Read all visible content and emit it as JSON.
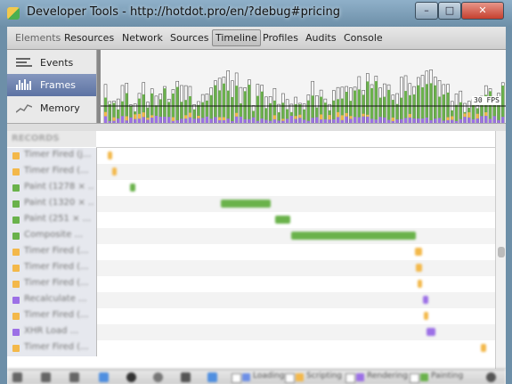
{
  "window": {
    "title": "Developer Tools - http://hotdot.pro/en/?debug#pricing",
    "min_label": "–",
    "max_label": "□",
    "close_label": "✕"
  },
  "tabs": [
    {
      "label": "Elements"
    },
    {
      "label": "Resources"
    },
    {
      "label": "Network"
    },
    {
      "label": "Sources"
    },
    {
      "label": "Timeline",
      "active": true
    },
    {
      "label": "Profiles"
    },
    {
      "label": "Audits"
    },
    {
      "label": "Console"
    }
  ],
  "sidebar": {
    "items": [
      {
        "label": "Events",
        "icon": "events-icon"
      },
      {
        "label": "Frames",
        "icon": "frames-icon",
        "active": true
      },
      {
        "label": "Memory",
        "icon": "memory-icon"
      }
    ]
  },
  "overview": {
    "fps_label": "30 FPS",
    "colors": {
      "scripting": "#f3b84a",
      "rendering": "#9c70e6",
      "painting": "#6ab24b",
      "total": "#ffffff"
    }
  },
  "records": {
    "header": "RECORDS",
    "rows": [
      {
        "label": "Timer Fired (j...",
        "category": "scripting"
      },
      {
        "label": "Timer Fired (...",
        "category": "scripting"
      },
      {
        "label": "Paint (1278 × ...",
        "category": "painting"
      },
      {
        "label": "Paint (1320 × ...",
        "category": "painting"
      },
      {
        "label": "Paint (251 × ...",
        "category": "painting"
      },
      {
        "label": "Composite ...",
        "category": "painting"
      },
      {
        "label": "Timer Fired (...",
        "category": "scripting"
      },
      {
        "label": "Timer Fired (...",
        "category": "scripting"
      },
      {
        "label": "Timer Fired (...",
        "category": "scripting"
      },
      {
        "label": "Recalculate ...",
        "category": "rendering"
      },
      {
        "label": "Timer Fired (...",
        "category": "scripting"
      },
      {
        "label": "XHR Load ...",
        "category": "rendering"
      },
      {
        "label": "Timer Fired (...",
        "category": "scripting"
      }
    ]
  },
  "statusbar": {
    "legend": [
      {
        "label": "Loading",
        "color": "#6d8fe6"
      },
      {
        "label": "Scripting",
        "color": "#f3b84a"
      },
      {
        "label": "Rendering",
        "color": "#9c70e6"
      },
      {
        "label": "Painting",
        "color": "#6ab24b"
      }
    ]
  }
}
